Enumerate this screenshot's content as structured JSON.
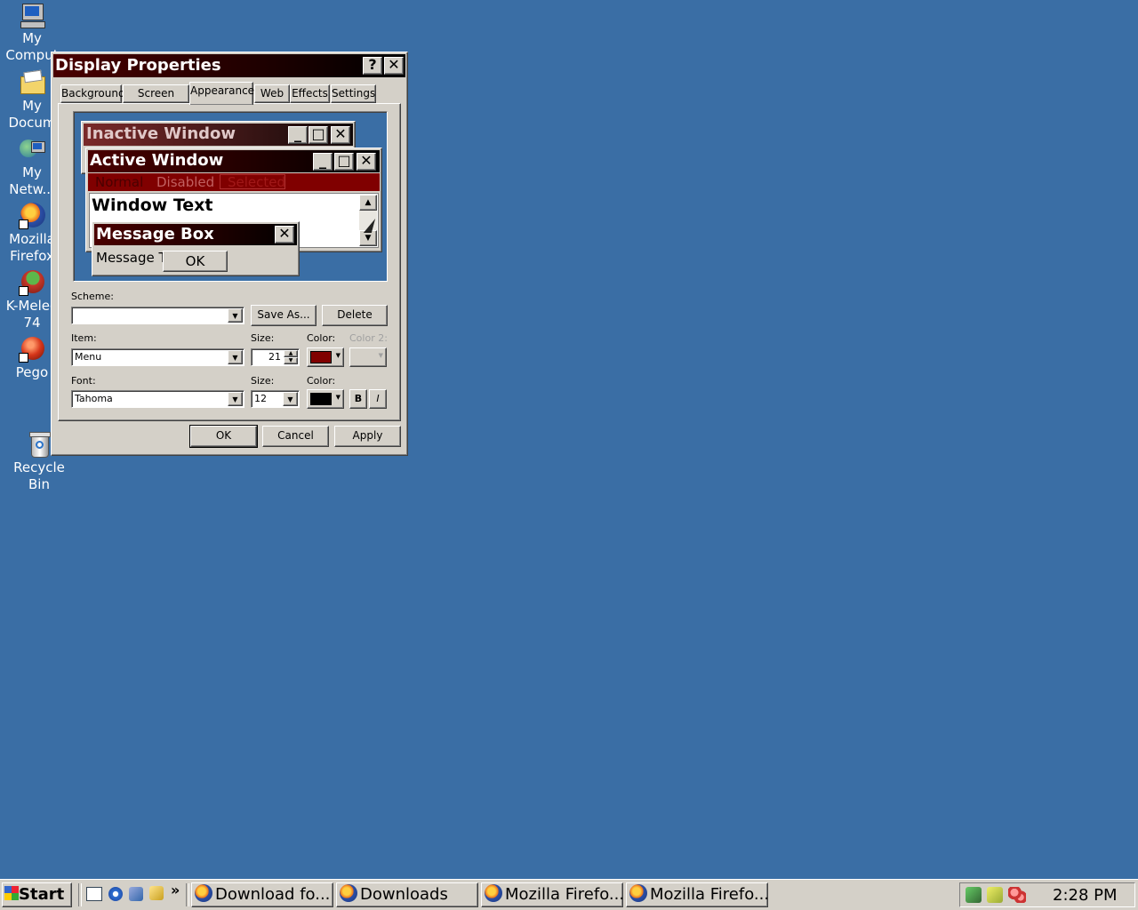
{
  "desktop": {
    "icons": [
      {
        "label_lines": [
          "My",
          "Comput"
        ],
        "icon": "computer-icon"
      },
      {
        "label_lines": [
          "My",
          "Docum"
        ],
        "icon": "folder-icon"
      },
      {
        "label_lines": [
          "My",
          "Netw..."
        ],
        "icon": "network-icon"
      },
      {
        "label_lines": [
          "Mozilla",
          "Firefox"
        ],
        "icon": "firefox-icon"
      },
      {
        "label_lines": [
          "K-Meleo",
          "74"
        ],
        "icon": "kmeleon-icon"
      },
      {
        "label_lines": [
          "Pego"
        ],
        "icon": "pego-icon"
      },
      {
        "label_lines": [
          "Recycle",
          "Bin"
        ],
        "icon": "recycle-bin-icon"
      }
    ],
    "background_color": "#3a6ea5"
  },
  "dialog": {
    "title": "Display Properties",
    "help_glyph": "?",
    "close_glyph": "✕",
    "tabs": [
      {
        "label": "Background"
      },
      {
        "label": "Screen Saver"
      },
      {
        "label": "Appearance",
        "active": true
      },
      {
        "label": "Web"
      },
      {
        "label": "Effects"
      },
      {
        "label": "Settings"
      }
    ],
    "preview": {
      "inactive_title": "Inactive Window",
      "active_title": "Active Window",
      "menu_normal": "Normal",
      "menu_disabled": "Disabled",
      "menu_selected": "Selected",
      "window_text": "Window Text",
      "message_box_title": "Message Box",
      "message_text": "Message Text",
      "ok": "OK"
    },
    "scheme_label": "Scheme:",
    "scheme_value": "",
    "save_as_label": "Save As...",
    "delete_label": "Delete",
    "item_label": "Item:",
    "item_value": "Menu",
    "item_size_label": "Size:",
    "item_size_value": "21",
    "item_color_label": "Color:",
    "item_color2_label": "Color 2:",
    "item_color": "#800000",
    "font_label": "Font:",
    "font_value": "Tahoma",
    "font_size_label": "Size:",
    "font_size_value": "12",
    "font_color_label": "Color:",
    "font_color": "#000000",
    "bold_label": "B",
    "italic_label": "I",
    "ok_label": "OK",
    "cancel_label": "Cancel",
    "apply_label": "Apply",
    "title_gradient": [
      "#4a0000",
      "#000000"
    ]
  },
  "taskbar": {
    "start_label": "Start",
    "chevron": "»",
    "buttons": [
      {
        "label": "Download fo...",
        "icon": "firefox-icon"
      },
      {
        "label": "Downloads",
        "icon": "firefox-icon"
      },
      {
        "label": "Mozilla Firefo...",
        "icon": "firefox-icon"
      },
      {
        "label": "Mozilla Firefo...",
        "icon": "firefox-icon"
      }
    ],
    "clock": "2:28 PM"
  }
}
